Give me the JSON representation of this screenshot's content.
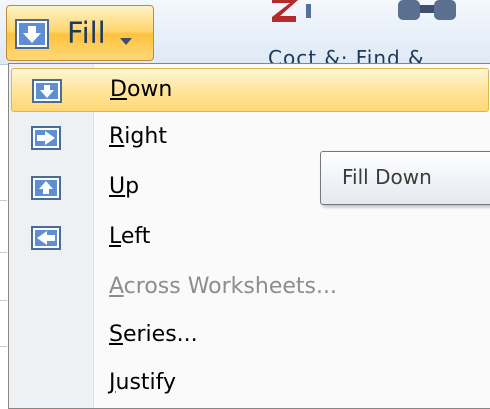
{
  "ribbon": {
    "fill_button": {
      "label": "Fill"
    }
  },
  "menu": {
    "items": [
      {
        "pre": "",
        "hotkey": "D",
        "post": "own",
        "icon": "fill-down-icon",
        "enabled": true,
        "highlighted": true
      },
      {
        "pre": "",
        "hotkey": "R",
        "post": "ight",
        "icon": "fill-right-icon",
        "enabled": true,
        "highlighted": false
      },
      {
        "pre": "",
        "hotkey": "U",
        "post": "p",
        "icon": "fill-up-icon",
        "enabled": true,
        "highlighted": false
      },
      {
        "pre": "",
        "hotkey": "L",
        "post": "eft",
        "icon": "fill-left-icon",
        "enabled": true,
        "highlighted": false
      },
      {
        "pre": "",
        "hotkey": "A",
        "post": "cross Worksheets...",
        "icon": "",
        "enabled": false,
        "highlighted": false
      },
      {
        "pre": "",
        "hotkey": "S",
        "post": "eries...",
        "icon": "",
        "enabled": true,
        "highlighted": false
      },
      {
        "pre": "",
        "hotkey": "J",
        "post": "ustify",
        "icon": "",
        "enabled": true,
        "highlighted": false
      }
    ]
  },
  "tooltip": {
    "text": "Fill Down"
  },
  "colors": {
    "accent_blue": "#3b6fb6",
    "highlight": "#ffe59c",
    "disabled_text": "#8d8d8d"
  }
}
